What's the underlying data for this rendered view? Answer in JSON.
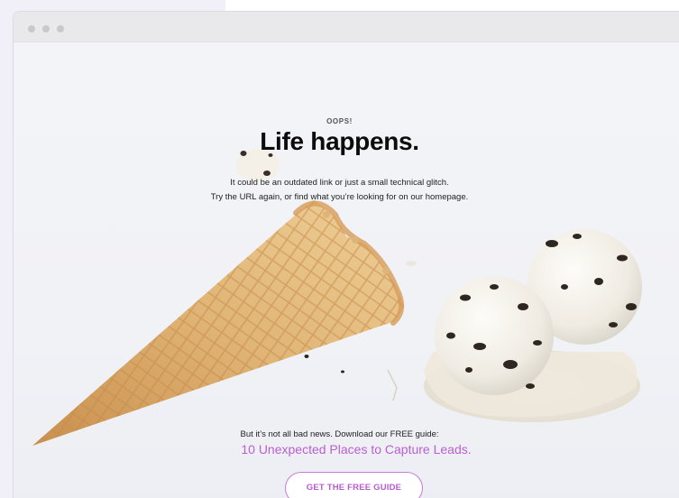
{
  "page": {
    "eyebrow": "OOPS!",
    "headline": "Life happens.",
    "description_line1": "It could be an outdated link or just a small technical glitch.",
    "description_line2": "Try the URL again, or find what you’re looking for on our homepage.",
    "news_text": "But it’s not all bad news. Download our FREE guide:",
    "guide_link": "10 Unexpected Places to Capture Leads.",
    "cta_label": "GET THE FREE GUIDE"
  },
  "colors": {
    "accent": "#b95fd0",
    "cta_border": "#c87ad8",
    "headline": "#0c0c0c",
    "titlebar": "#e9e9eb"
  },
  "icons": [
    "window-control-dots"
  ]
}
